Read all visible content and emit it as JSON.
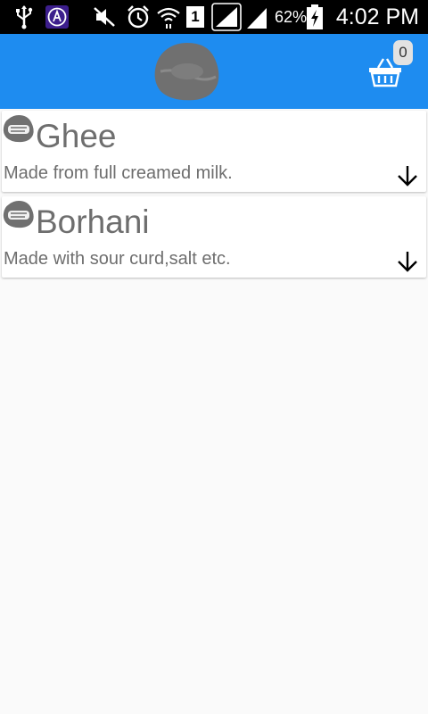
{
  "status_bar": {
    "sim_slot": "1",
    "battery_percent": "62%",
    "time": "4:02 PM",
    "icons": [
      "usb-icon",
      "app-notification-icon",
      "mute-icon",
      "alarm-icon",
      "wifi-icon",
      "sim-slot-icon",
      "signal-icon",
      "signal-icon",
      "battery-charging-icon"
    ]
  },
  "app_bar": {
    "background_color": "#1e8cf0",
    "logo_icon": "aarong-dairy-logo",
    "cart_icon": "shopping-basket-icon",
    "cart_count": "0"
  },
  "products": [
    {
      "name": "Ghee",
      "description": "Made from full creamed milk.",
      "icon": "aarong-dairy-logo",
      "action_icon": "arrow-down-icon"
    },
    {
      "name": "Borhani",
      "description": "Made with sour curd,salt etc.",
      "icon": "aarong-dairy-logo",
      "action_icon": "arrow-down-icon"
    }
  ]
}
